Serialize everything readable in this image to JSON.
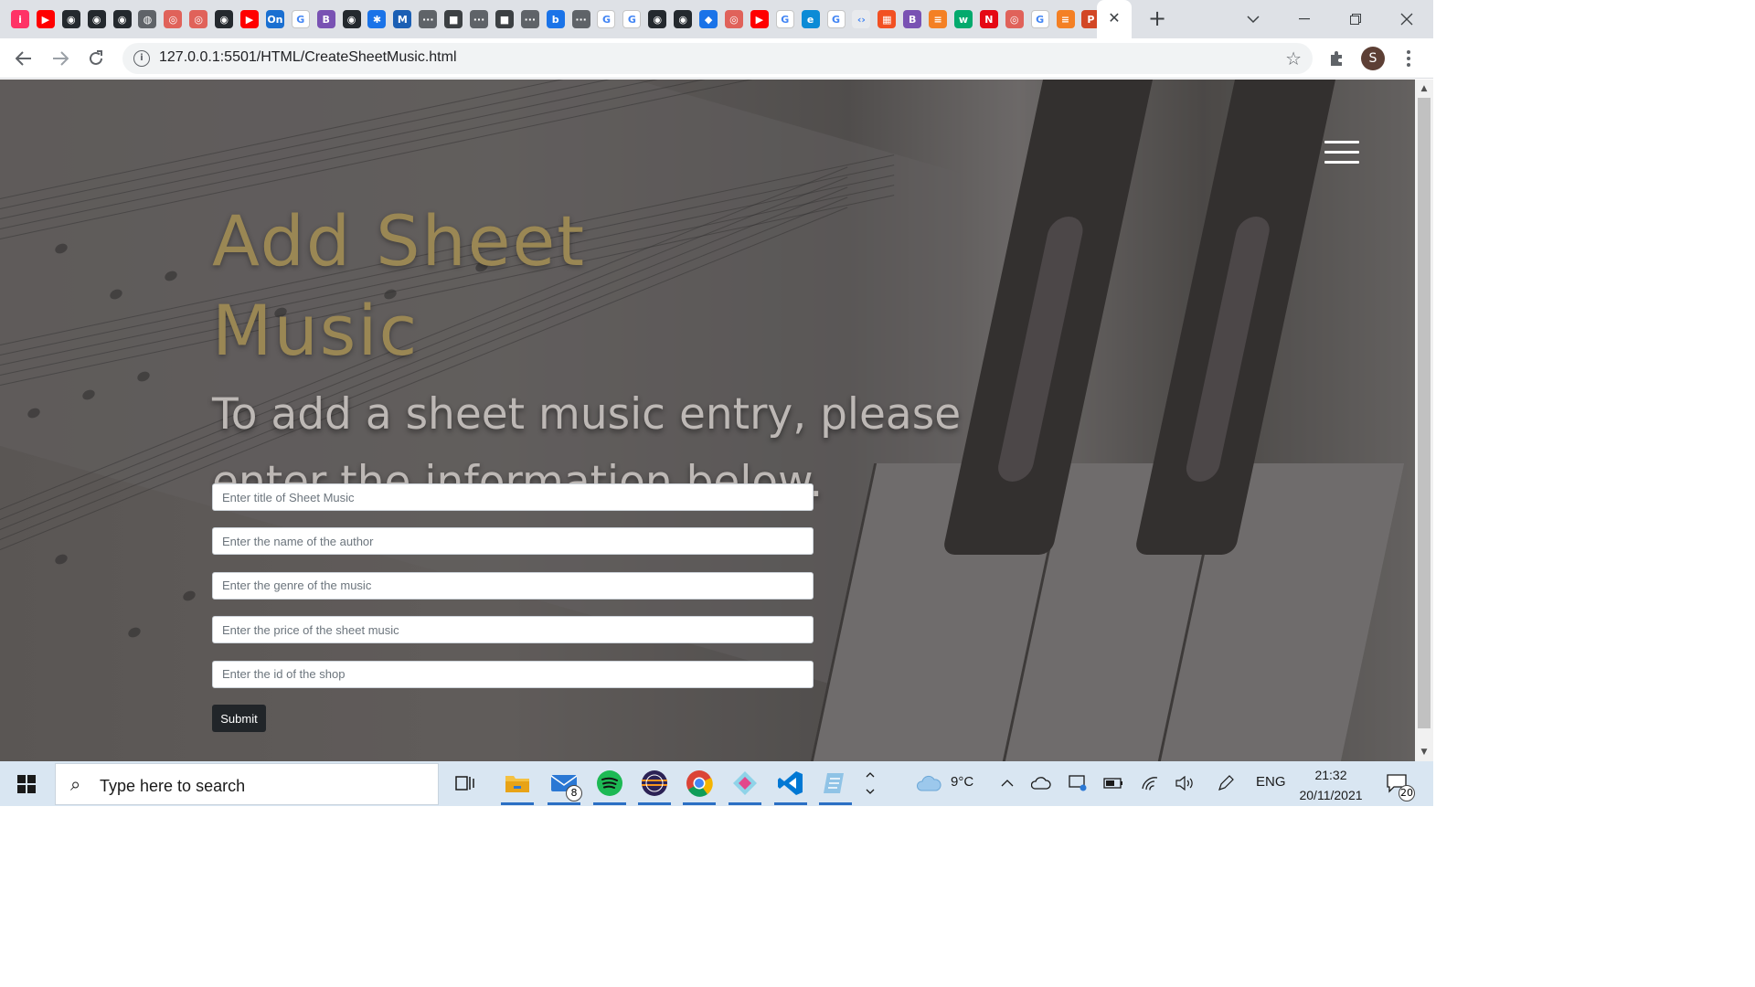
{
  "browser": {
    "tab_favicons": [
      "invision",
      "youtube",
      "github",
      "github",
      "github",
      "globe",
      "artstation",
      "artstation",
      "github",
      "youtube",
      "onshape",
      "google",
      "bootstrap",
      "github",
      "settings",
      "mdn",
      "dots",
      "app",
      "dots",
      "app",
      "dots",
      "bing",
      "dots",
      "google",
      "google",
      "github",
      "github",
      "maps",
      "artstation",
      "youtube",
      "google",
      "edge",
      "google",
      "code",
      "windows",
      "bootstrap",
      "stack",
      "w3",
      "netflix",
      "artstation",
      "google",
      "stack",
      "powerpoint"
    ],
    "tab_close_glyph": "✕",
    "new_tab_glyph": "+",
    "url": "127.0.0.1:5501/HTML/CreateSheetMusic.html",
    "profile_initial": "S"
  },
  "page": {
    "title": "Add Sheet Music",
    "subtitle": "To add a sheet music entry, please enter the information below.",
    "form": {
      "title_placeholder": "Enter title of Sheet Music",
      "author_placeholder": "Enter the name of the author",
      "genre_placeholder": "Enter the genre of the music",
      "price_placeholder": "Enter the price of the sheet music",
      "shop_placeholder": "Enter the id of the shop",
      "submit_label": "Submit"
    }
  },
  "taskbar": {
    "search_placeholder": "Type here to search",
    "mail_badge": "8",
    "weather": "9°C",
    "language": "ENG",
    "time": "21:32",
    "date": "20/11/2021",
    "notifications": "20"
  },
  "colors": {
    "heading": "#9a8754",
    "subheading": "#bdb8b5",
    "submit_bg": "#212529",
    "taskbar_bg": "#d9e6f2"
  }
}
